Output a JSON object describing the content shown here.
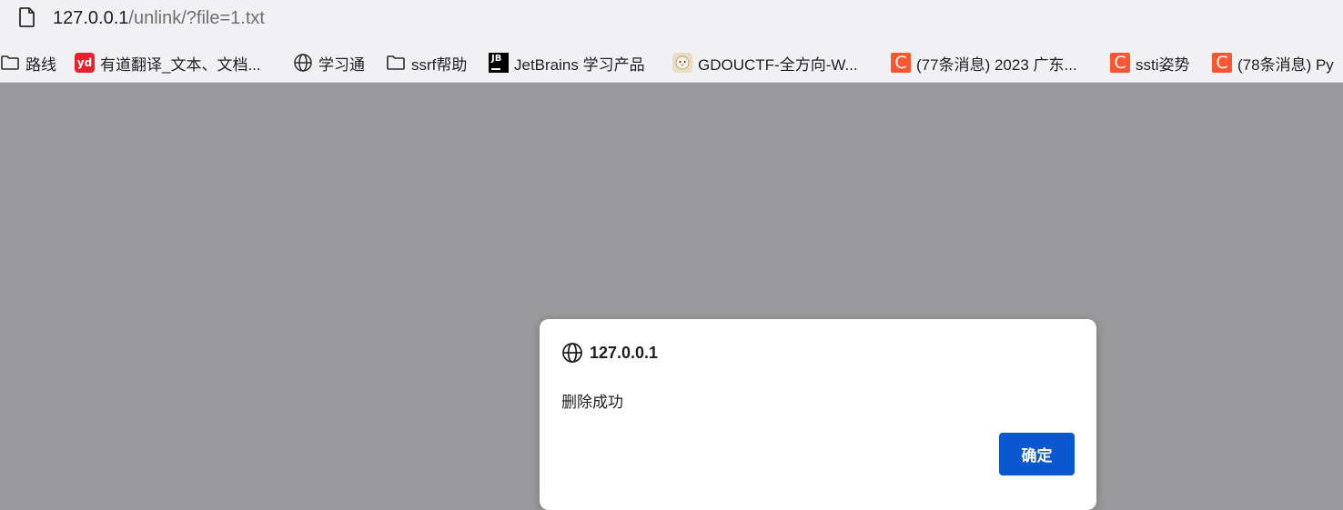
{
  "address_bar": {
    "url_host": "127.0.0.1",
    "url_path": "/unlink/?file=1.txt",
    "page_icon": "document-icon"
  },
  "bookmarks": [
    {
      "label": "路线",
      "icon": "folder-icon"
    },
    {
      "label": "有道翻译_文本、文档...",
      "icon": "youdao-icon",
      "icon_text": "yd"
    },
    {
      "label": "学习通",
      "icon": "globe-icon"
    },
    {
      "label": "ssrf帮助",
      "icon": "folder-icon"
    },
    {
      "label": "JetBrains 学习产品",
      "icon": "jetbrains-icon",
      "icon_text": "JB"
    },
    {
      "label": "GDOUCTF-全方向-W...",
      "icon": "sheep-icon"
    },
    {
      "label": "(77条消息) 2023 广东...",
      "icon": "csdn-icon",
      "icon_text": "C"
    },
    {
      "label": "ssti姿势",
      "icon": "csdn-icon",
      "icon_text": "C"
    },
    {
      "label": "(78条消息) Py",
      "icon": "csdn-icon",
      "icon_text": "C"
    }
  ],
  "dialog": {
    "title": "127.0.0.1",
    "message": "删除成功",
    "ok_label": "确定",
    "title_icon": "globe-icon"
  },
  "colors": {
    "overlay": "#9a9a9c",
    "chrome": "#f1f1f4",
    "button": "#0b57d0",
    "csdn": "#fc5531",
    "youdao": "#e8212d"
  }
}
